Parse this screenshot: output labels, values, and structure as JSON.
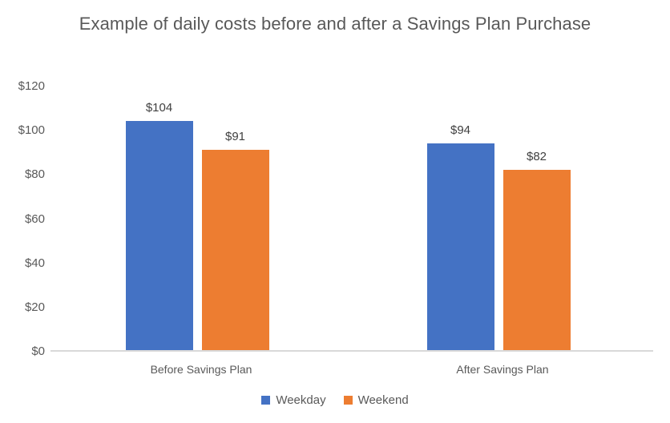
{
  "chart_data": {
    "type": "bar",
    "title": "Example of daily costs before and after a Savings Plan Purchase",
    "xlabel": "",
    "ylabel": "",
    "categories": [
      "Before Savings Plan",
      "After Savings Plan"
    ],
    "series": [
      {
        "name": "Weekday",
        "color": "#4472C4",
        "values": [
          104,
          91
        ]
      },
      {
        "name": "Weekend",
        "color": "#ED7D31",
        "values": [
          94,
          82
        ]
      }
    ],
    "series_order_note": "grouped: each category shows Weekday then Weekend",
    "grouped_values": [
      {
        "category": "Before Savings Plan",
        "Weekday": 104,
        "Weekend": 91
      },
      {
        "category": "After Savings Plan",
        "Weekday": 94,
        "Weekend": 82
      }
    ],
    "data_labels": [
      "$104",
      "$91",
      "$94",
      "$82"
    ],
    "ylim": [
      0,
      120
    ],
    "ytick_values": [
      0,
      20,
      40,
      60,
      80,
      100,
      120
    ],
    "ytick_labels": [
      "$0",
      "$20",
      "$40",
      "$60",
      "$80",
      "$100",
      "$120"
    ],
    "grid": false,
    "legend_position": "bottom",
    "legend_entries": [
      "Weekday",
      "Weekend"
    ],
    "axis_line_color": "#D9D9D9",
    "text_color": "#595959"
  },
  "title": {
    "line1": "Example of daily costs before and after a Savings Plan",
    "line2": "Purchase"
  },
  "yaxis": {
    "ticks": [
      {
        "label": "$120",
        "value": 120
      },
      {
        "label": "$100",
        "value": 100
      },
      {
        "label": "$80",
        "value": 80
      },
      {
        "label": "$60",
        "value": 60
      },
      {
        "label": "$40",
        "value": 40
      },
      {
        "label": "$20",
        "value": 20
      },
      {
        "label": "$0",
        "value": 0
      }
    ]
  },
  "xaxis": {
    "categories": [
      {
        "label": "Before Savings Plan"
      },
      {
        "label": "After Savings Plan"
      }
    ]
  },
  "bars": [
    {
      "series": "Weekday",
      "category": "Before Savings Plan",
      "value": 104,
      "label": "$104",
      "color": "#4472C4"
    },
    {
      "series": "Weekend",
      "category": "Before Savings Plan",
      "value": 91,
      "label": "$91",
      "color": "#ED7D31"
    },
    {
      "series": "Weekday",
      "category": "After Savings Plan",
      "value": 94,
      "label": "$94",
      "color": "#4472C4"
    },
    {
      "series": "Weekend",
      "category": "After Savings Plan",
      "value": 82,
      "label": "$82",
      "color": "#ED7D31"
    }
  ],
  "legend": {
    "items": [
      {
        "label": "Weekday",
        "color": "#4472C4"
      },
      {
        "label": "Weekend",
        "color": "#ED7D31"
      }
    ]
  }
}
